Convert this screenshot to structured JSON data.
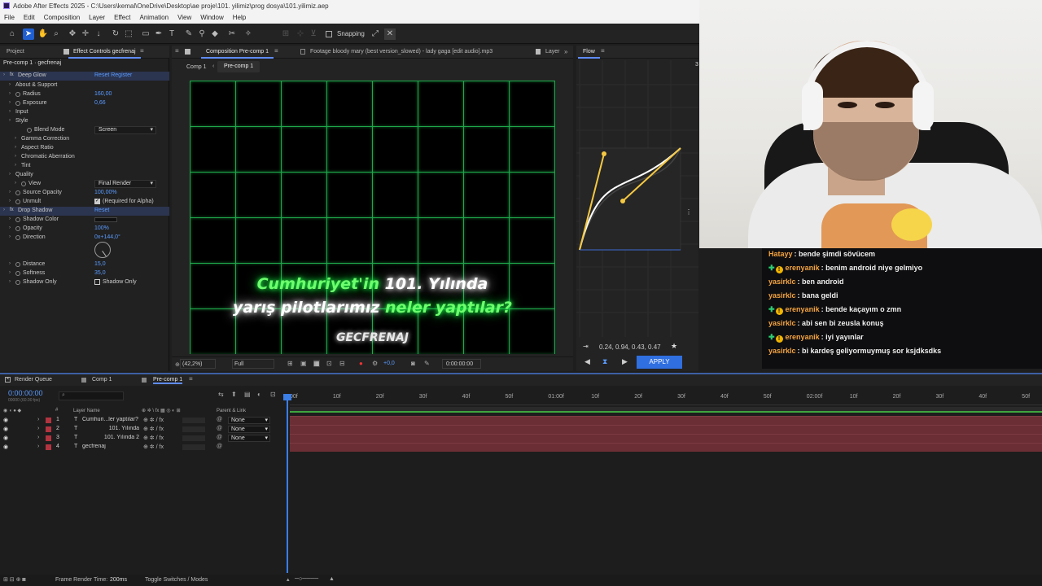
{
  "titlebar": {
    "title": "Adobe After Effects 2025 - C:\\Users\\kemal\\OneDrive\\Desktop\\ae proje\\101. yilimiz\\prog dosya\\101.yilimiz.aep"
  },
  "menu": [
    "File",
    "Edit",
    "Composition",
    "Layer",
    "Effect",
    "Animation",
    "View",
    "Window",
    "Help"
  ],
  "toolbar": {
    "snapping": "Snapping"
  },
  "effect_controls": {
    "tab_project": "Project",
    "tab_effect": "Effect Controls gecfrenaj",
    "layer_path": "Pre-comp 1 · gecfrenaj",
    "rows": [
      {
        "name": "Deep Glow",
        "value": "",
        "extra": "Reset   Register",
        "indent": 0,
        "fx": true,
        "hl": true
      },
      {
        "name": "About & Support",
        "value": "",
        "indent": 1
      },
      {
        "name": "Radius",
        "value": "160,00",
        "indent": 1,
        "sw": true
      },
      {
        "name": "Exposure",
        "value": "0,66",
        "indent": 1,
        "sw": true
      },
      {
        "name": "Input",
        "value": "",
        "indent": 1
      },
      {
        "name": "Style",
        "value": "",
        "indent": 1
      },
      {
        "name": "Blend Mode",
        "value": "",
        "dropdown": "Screen",
        "indent": 3,
        "sw": true
      },
      {
        "name": "Gamma Correction",
        "value": "",
        "indent": 2
      },
      {
        "name": "Aspect Ratio",
        "value": "",
        "indent": 2
      },
      {
        "name": "Chromatic Aberration",
        "value": "",
        "indent": 2
      },
      {
        "name": "Tint",
        "value": "",
        "indent": 2
      },
      {
        "name": "Quality",
        "value": "",
        "indent": 1
      },
      {
        "name": "View",
        "value": "",
        "dropdown": "Final Render",
        "indent": 2,
        "sw": true
      },
      {
        "name": "Source Opacity",
        "value": "100,00%",
        "indent": 1,
        "sw": true
      },
      {
        "name": "Unmult",
        "value": "",
        "check": "(Required for Alpha)",
        "indent": 1,
        "sw": true
      },
      {
        "name": "Drop Shadow",
        "value": "",
        "extra": "Reset",
        "indent": 0,
        "fx": true,
        "hl": true
      },
      {
        "name": "Shadow Color",
        "value": "",
        "indent": 1,
        "sw": true
      },
      {
        "name": "Opacity",
        "value": "100%",
        "indent": 1,
        "sw": true
      },
      {
        "name": "Direction",
        "value": "0x+144,0°",
        "indent": 1,
        "sw": true
      }
    ],
    "rows2": [
      {
        "name": "Distance",
        "value": "15,0"
      },
      {
        "name": "Softness",
        "value": "35,0"
      },
      {
        "name": "Shadow Only",
        "value": "",
        "check": "Shadow Only"
      }
    ]
  },
  "comp": {
    "tab": "Composition Pre-comp 1",
    "footage_tab": "Footage bloody mary (best version_slowed) - lady gaga [edit audio].mp3",
    "layer_tab": "Layer",
    "breadcrumb1": "Comp 1",
    "breadcrumb2": "Pre-comp 1",
    "text_line1a": "Cumhuriyet'in",
    "text_line1b": "101. Yılında",
    "text_line2a": "yarış pilotlarımız",
    "text_line2b": "neler yaptılar?",
    "text_line3": "GECFRENAJ",
    "zoom": "(42,2%)",
    "resolution": "Full",
    "exposure": "+0,0",
    "timecode": "0:00:00:00"
  },
  "flow": {
    "tab": "Flow",
    "values": "0.24, 0.94, 0.43, 0.47",
    "apply": "APPLY",
    "edge_number": "3"
  },
  "chat": [
    {
      "user": "Hatayy",
      "color": "#f4a340",
      "text": "bende şimdi sövücem",
      "badge": false
    },
    {
      "user": "erenyanik",
      "color": "#f4a340",
      "text": "benim android niye gelmiyo",
      "badge": true
    },
    {
      "user": "yasirklc",
      "color": "#f4a340",
      "text": "ben android",
      "badge": false
    },
    {
      "user": "yasirklc",
      "color": "#f4a340",
      "text": "bana geldi",
      "badge": false
    },
    {
      "user": "erenyanik",
      "color": "#f4a340",
      "text": "bende kaçayım o zmn",
      "badge": true
    },
    {
      "user": "yasirklc",
      "color": "#f4a340",
      "text": "abi sen bi zeusla konuş",
      "badge": false
    },
    {
      "user": "erenyanik",
      "color": "#f4a340",
      "text": "iyi yayınlar",
      "badge": true
    },
    {
      "user": "yasirklc",
      "color": "#f4a340",
      "text": "bi kardeş geliyormuymuş sor ksjdksdks",
      "badge": false
    }
  ],
  "timeline": {
    "tabs": [
      "Render Queue",
      "Comp 1",
      "Pre-comp 1"
    ],
    "timecode": "0:00:00:00",
    "fps": "00000 (60.00 fps)",
    "col_layer": "Layer Name",
    "col_parent": "Parent & Link",
    "ticks": [
      "00f",
      "10f",
      "20f",
      "30f",
      "40f",
      "50f",
      "01:00f",
      "10f",
      "20f",
      "30f",
      "40f",
      "50f",
      "02:00f",
      "10f",
      "20f",
      "30f",
      "40f",
      "50f"
    ],
    "layers": [
      {
        "num": "1",
        "type": "T",
        "name": "Cumhuri...ler yaptılar?",
        "parent": "None"
      },
      {
        "num": "2",
        "type": "T",
        "name": "101. Yılında",
        "parent": "None"
      },
      {
        "num": "3",
        "type": "T",
        "name": "101. Yılında 2",
        "parent": "None"
      },
      {
        "num": "4",
        "type": "T",
        "name": "gecfrenaj",
        "parent": ""
      }
    ],
    "frame_render": "Frame Render Time:",
    "frame_render_val": "200ms",
    "toggle": "Toggle Switches / Modes"
  }
}
